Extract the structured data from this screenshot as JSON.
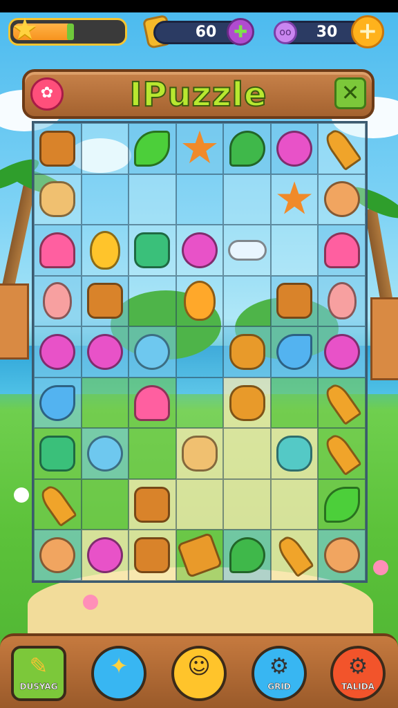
{
  "hud": {
    "progress": 0.55,
    "coins": "60",
    "gems": "30",
    "gem_badge": "oo"
  },
  "title": {
    "text": "IPuzzle",
    "menu_glyph": "✿",
    "close_glyph": "✕"
  },
  "grid": {
    "rows": 9,
    "cols": 7,
    "cells": [
      [
        {
          "t": "t-blue",
          "p": "monkey"
        },
        {
          "t": "t-light",
          "p": ""
        },
        {
          "t": "t-blue",
          "p": "leaf"
        },
        {
          "t": "t-blue",
          "p": "star"
        },
        {
          "t": "t-blue",
          "p": "pepper"
        },
        {
          "t": "t-blue",
          "p": "elephant"
        },
        {
          "t": "t-light",
          "p": "carrot"
        }
      ],
      [
        {
          "t": "t-light",
          "p": "bunny"
        },
        {
          "t": "t-empty",
          "p": ""
        },
        {
          "t": "t-light",
          "p": ""
        },
        {
          "t": "t-empty",
          "p": ""
        },
        {
          "t": "t-light",
          "p": ""
        },
        {
          "t": "t-light",
          "p": "star"
        },
        {
          "t": "t-light",
          "p": "girl"
        }
      ],
      [
        {
          "t": "t-blue",
          "p": "mushroom"
        },
        {
          "t": "t-empty",
          "p": "balloon"
        },
        {
          "t": "t-light",
          "p": "frog"
        },
        {
          "t": "t-light",
          "p": "elephant"
        },
        {
          "t": "t-light",
          "p": "cloud"
        },
        {
          "t": "t-light",
          "p": ""
        },
        {
          "t": "t-blue",
          "p": "mushroom"
        }
      ],
      [
        {
          "t": "t-blue",
          "p": "egg"
        },
        {
          "t": "t-blue",
          "p": "monkey"
        },
        {
          "t": "t-empty",
          "p": ""
        },
        {
          "t": "t-empty",
          "p": "orange-balloon"
        },
        {
          "t": "t-empty",
          "p": ""
        },
        {
          "t": "t-blue",
          "p": "monkey"
        },
        {
          "t": "t-blue",
          "p": "egg"
        }
      ],
      [
        {
          "t": "t-blue",
          "p": "elephant"
        },
        {
          "t": "t-blue",
          "p": "elephant"
        },
        {
          "t": "t-blue",
          "p": "blob"
        },
        {
          "t": "t-empty",
          "p": ""
        },
        {
          "t": "t-blue",
          "p": "toad"
        },
        {
          "t": "t-blue",
          "p": "drop"
        },
        {
          "t": "t-blue",
          "p": "elephant"
        }
      ],
      [
        {
          "t": "t-blue",
          "p": "drop"
        },
        {
          "t": "t-green",
          "p": ""
        },
        {
          "t": "t-green",
          "p": "mushroom"
        },
        {
          "t": "t-empty",
          "p": ""
        },
        {
          "t": "t-cream",
          "p": "toad"
        },
        {
          "t": "t-green",
          "p": ""
        },
        {
          "t": "t-green",
          "p": "carrot"
        }
      ],
      [
        {
          "t": "t-green",
          "p": "frog"
        },
        {
          "t": "t-blue",
          "p": "blob"
        },
        {
          "t": "t-green",
          "p": ""
        },
        {
          "t": "t-cream",
          "p": "bunny"
        },
        {
          "t": "t-cream",
          "p": ""
        },
        {
          "t": "t-cream",
          "p": "slug"
        },
        {
          "t": "t-green",
          "p": "carrot"
        }
      ],
      [
        {
          "t": "t-green",
          "p": "carrot"
        },
        {
          "t": "t-green",
          "p": ""
        },
        {
          "t": "t-cream",
          "p": "monkey"
        },
        {
          "t": "t-cream",
          "p": ""
        },
        {
          "t": "t-cream",
          "p": ""
        },
        {
          "t": "t-cream",
          "p": ""
        },
        {
          "t": "t-green",
          "p": "leaf"
        }
      ],
      [
        {
          "t": "t-blue",
          "p": "girl"
        },
        {
          "t": "t-cream",
          "p": "elephant"
        },
        {
          "t": "t-cream",
          "p": "monkey"
        },
        {
          "t": "t-green",
          "p": "jar"
        },
        {
          "t": "t-blue",
          "p": "pepper"
        },
        {
          "t": "t-cream",
          "p": "carrot"
        },
        {
          "t": "t-blue",
          "p": "girl"
        }
      ]
    ]
  },
  "dock": {
    "buttons": [
      {
        "name": "eraser-button",
        "glyph": "✎",
        "label": "DUSYAG"
      },
      {
        "name": "hint-button",
        "glyph": "✦",
        "label": ""
      },
      {
        "name": "pet-button",
        "glyph": "☺",
        "label": ""
      },
      {
        "name": "settings-button",
        "glyph": "⚙",
        "label": "GRID"
      },
      {
        "name": "tools-button",
        "glyph": "⚙",
        "label": "TALIDA"
      }
    ]
  },
  "colors": {
    "accent": "#b8e830",
    "wood": "#a4622f",
    "sky": "#49b9ee"
  }
}
